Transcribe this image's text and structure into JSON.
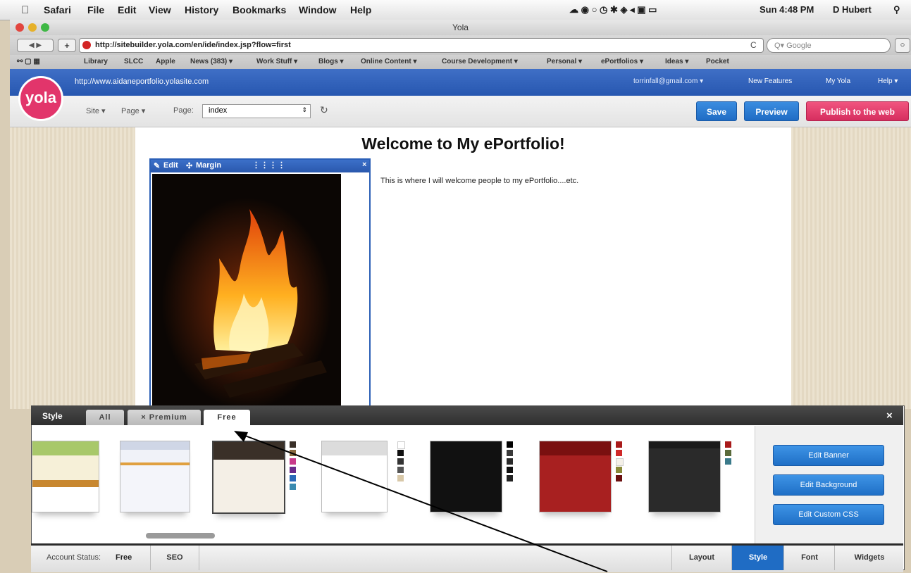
{
  "menubar": {
    "app": "Safari",
    "items": [
      "File",
      "Edit",
      "View",
      "History",
      "Bookmarks",
      "Window",
      "Help"
    ],
    "clock": "Sun 4:48 PM",
    "user": "D Hubert"
  },
  "window": {
    "title": "Yola"
  },
  "toolbar": {
    "url": "http://sitebuilder.yola.com/en/ide/index.jsp?flow=first",
    "search_placeholder": "Q▾ Google"
  },
  "bookmarks": [
    "Library",
    "SLCC",
    "Apple",
    "News (383) ▾",
    "Work Stuff ▾",
    "Blogs ▾",
    "Online Content ▾",
    "Course Development ▾",
    "Personal ▾",
    "ePortfolios ▾",
    "Ideas ▾",
    "Pocket"
  ],
  "yola": {
    "logo": "yola",
    "site_url": "http://www.aidaneportfolio.yolasite.com",
    "email": "torrinfall@gmail.com ▾",
    "links": [
      "New Features",
      "My Yola",
      "Help ▾"
    ],
    "site_menu": "Site ▾",
    "page_menu": "Page ▾",
    "page_label": "Page:",
    "page_select": "index",
    "save": "Save",
    "preview": "Preview",
    "publish": "Publish to the web"
  },
  "page": {
    "heading": "Welcome to My ePortfolio!",
    "body": "This is where I will welcome people to my ePortfolio....etc.",
    "widget_edit": "Edit",
    "widget_margin": "Margin",
    "widget_close": "×"
  },
  "style_panel": {
    "title": "Style",
    "tabs": [
      "All",
      "× Premium",
      "Free"
    ],
    "close": "×",
    "buttons": [
      "Edit Banner",
      "Edit Background",
      "Edit Custom CSS"
    ]
  },
  "bottom": {
    "account_label": "Account Status:",
    "account_value": "Free",
    "seo": "SEO",
    "tabs": [
      "Layout",
      "Style",
      "Font",
      "Widgets"
    ]
  },
  "colors": {
    "yola_blue": "#2f62bb",
    "accent_pink": "#e2356b",
    "active_tab": "#1f6cc4"
  }
}
